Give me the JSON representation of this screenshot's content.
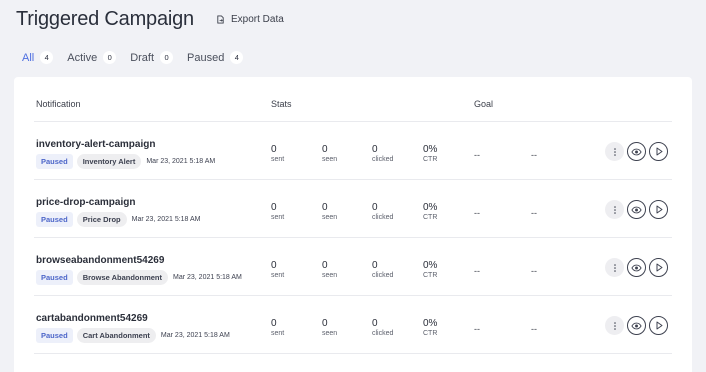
{
  "header": {
    "title": "Triggered Campaign",
    "export_label": "Export Data"
  },
  "tabs": [
    {
      "label": "All",
      "count": "4"
    },
    {
      "label": "Active",
      "count": "0"
    },
    {
      "label": "Draft",
      "count": "0"
    },
    {
      "label": "Paused",
      "count": "4"
    }
  ],
  "table": {
    "headers": {
      "notification": "Notification",
      "stats": "Stats",
      "goal": "Goal"
    },
    "stat_labels": {
      "sent": "sent",
      "seen": "seen",
      "clicked": "clicked",
      "ctr": "CTR"
    },
    "rows": [
      {
        "name": "inventory-alert-campaign",
        "status": "Paused",
        "type": "Inventory Alert",
        "date": "Mar 23, 2021 5:18 AM",
        "sent": "0",
        "seen": "0",
        "clicked": "0",
        "ctr": "0%",
        "goal1": "--",
        "goal2": "--"
      },
      {
        "name": "price-drop-campaign",
        "status": "Paused",
        "type": "Price Drop",
        "date": "Mar 23, 2021 5:18 AM",
        "sent": "0",
        "seen": "0",
        "clicked": "0",
        "ctr": "0%",
        "goal1": "--",
        "goal2": "--"
      },
      {
        "name": "browseabandonment54269",
        "status": "Paused",
        "type": "Browse Abandonment",
        "date": "Mar 23, 2021 5:18 AM",
        "sent": "0",
        "seen": "0",
        "clicked": "0",
        "ctr": "0%",
        "goal1": "--",
        "goal2": "--"
      },
      {
        "name": "cartabandonment54269",
        "status": "Paused",
        "type": "Cart Abandonment",
        "date": "Mar 23, 2021 5:18 AM",
        "sent": "0",
        "seen": "0",
        "clicked": "0",
        "ctr": "0%",
        "goal1": "--",
        "goal2": "--"
      }
    ]
  },
  "icons": {
    "export": "export-icon",
    "more": "more-vertical-icon",
    "view": "eye-icon",
    "play": "play-icon"
  },
  "colors": {
    "accent": "#4d6ee0",
    "background": "#f1f2f6",
    "status_badge_text": "#4d66c9"
  }
}
